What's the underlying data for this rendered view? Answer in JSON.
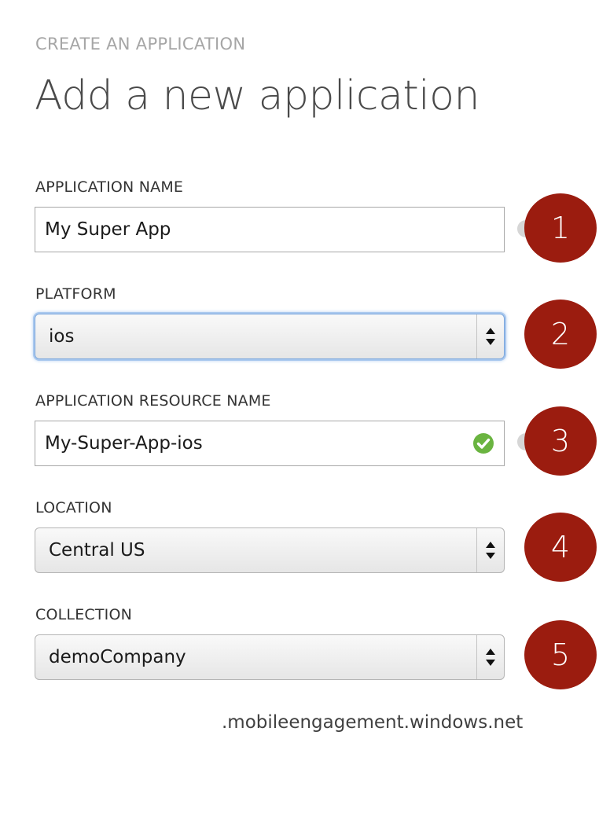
{
  "header": {
    "overline": "CREATE AN APPLICATION",
    "title": "Add a new application"
  },
  "fields": {
    "app_name": {
      "label": "APPLICATION NAME",
      "value": "My Super App",
      "step": "1"
    },
    "platform": {
      "label": "PLATFORM",
      "value": "ios",
      "step": "2"
    },
    "resource_name": {
      "label": "APPLICATION RESOURCE NAME",
      "value": "My-Super-App-ios",
      "step": "3",
      "status_icon": "check-circle-icon",
      "status_color": "#6ab440"
    },
    "location": {
      "label": "LOCATION",
      "value": "Central US",
      "step": "4"
    },
    "collection": {
      "label": "COLLECTION",
      "value": "demoCompany",
      "step": "5"
    }
  },
  "domain_suffix": ".mobileengagement.windows.net",
  "colors": {
    "step_badge": "#9b1c0f",
    "focus_ring": "#7aa6dd"
  }
}
